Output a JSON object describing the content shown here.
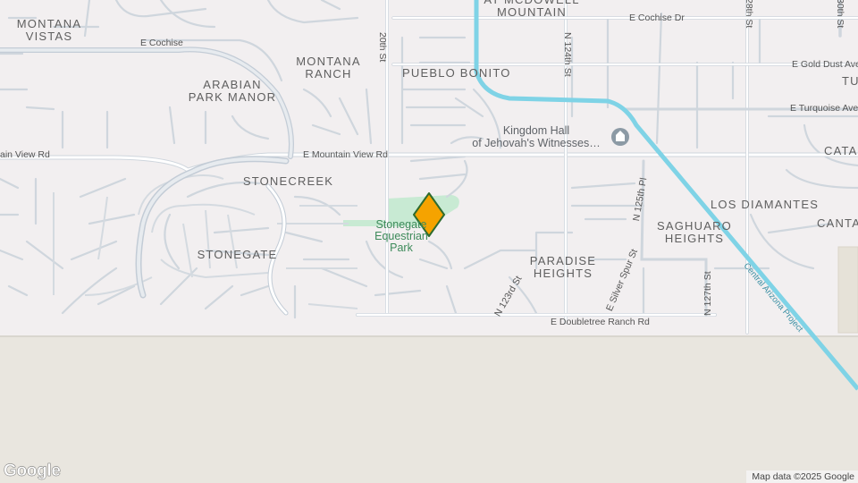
{
  "areas": {
    "montana_vistas": "MONTANA\nVISTAS",
    "mcdowell_mountain": "AT MCDOWELL\nMOUNTAIN",
    "montana_ranch": "MONTANA\nRANCH",
    "pueblo_bonito": "PUEBLO BONITO",
    "arabian_park_manor": "ARABIAN\nPARK MANOR",
    "stonecreek": "STONECREEK",
    "stonegate": "STONEGATE",
    "paradise_heights": "PARADISE\nHEIGHTS",
    "saghuaro_heights": "SAGHUARO\nHEIGHTS",
    "los_diamantes": "LOS DIAMANTES",
    "cata": "CATA",
    "canta": "CANTA",
    "tu": "TU"
  },
  "roads": {
    "e_cochise_left": "E Cochise",
    "e_cochise_dr": "E Cochise Dr",
    "e_gold_dust": "E Gold Dust Ave",
    "e_turquoise": "E Turquoise Ave",
    "mountain_view_left": "ain View Rd",
    "mountain_view_mid": "E Mountain View Rd",
    "n_120th": "20th St",
    "n_124th": "N 124th St",
    "n_128th": "28th St",
    "n_130th": "30th St",
    "n_125th_pl": "N 125th Pl",
    "n_123rd": "N 123rd St",
    "silver_spur": "E Silver Spur St",
    "n_127th": "N 127th St",
    "doubletree": "E Doubletree Ranch Rd",
    "canal": "Central Arizona Project"
  },
  "poi": {
    "kingdom_hall": "Kingdom Hall\nof Jehovah's Witnesses…",
    "park": "Stonegate\nEquestrian\nPark"
  },
  "marker": {
    "color": "#f5a300",
    "outline": "#2e6b2e"
  },
  "colors": {
    "canal": "#7fd3e6",
    "park": "#c8ead3",
    "desert": "#e9e6df",
    "road": "#ffffff",
    "road_edge": "#cfd6dd",
    "highway": "#c3ccd6"
  },
  "logo": "Google",
  "attribution": "Map data ©2025 Google"
}
